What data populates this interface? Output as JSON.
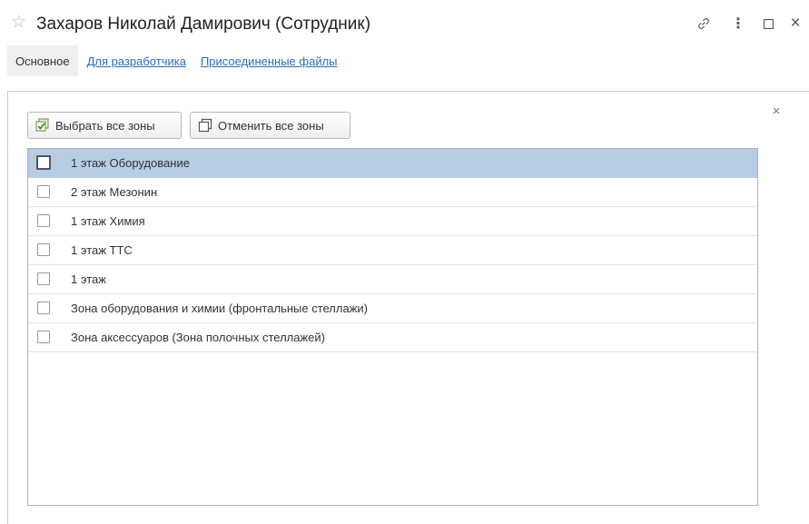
{
  "window": {
    "title": "Захаров Николай Дамирович (Сотрудник)"
  },
  "tabs": [
    {
      "label": "Основное"
    },
    {
      "label": "Для разработчика"
    },
    {
      "label": "Присоединенные файлы"
    }
  ],
  "toolbar": {
    "select_all_label": "Выбрать все зоны",
    "cancel_all_label": "Отменить все зоны"
  },
  "zones": [
    {
      "label": "1 этаж Оборудование",
      "checked": false,
      "selected": true
    },
    {
      "label": "2 этаж Мезонин",
      "checked": false,
      "selected": false
    },
    {
      "label": "1 этаж Химия",
      "checked": false,
      "selected": false
    },
    {
      "label": "1 этаж ТТС",
      "checked": false,
      "selected": false
    },
    {
      "label": "1 этаж",
      "checked": false,
      "selected": false
    },
    {
      "label": "Зона оборудования и химии (фронтальные стеллажи)",
      "checked": false,
      "selected": false
    },
    {
      "label": "Зона аксессуаров (Зона полочных стеллажей)",
      "checked": false,
      "selected": false
    }
  ]
}
